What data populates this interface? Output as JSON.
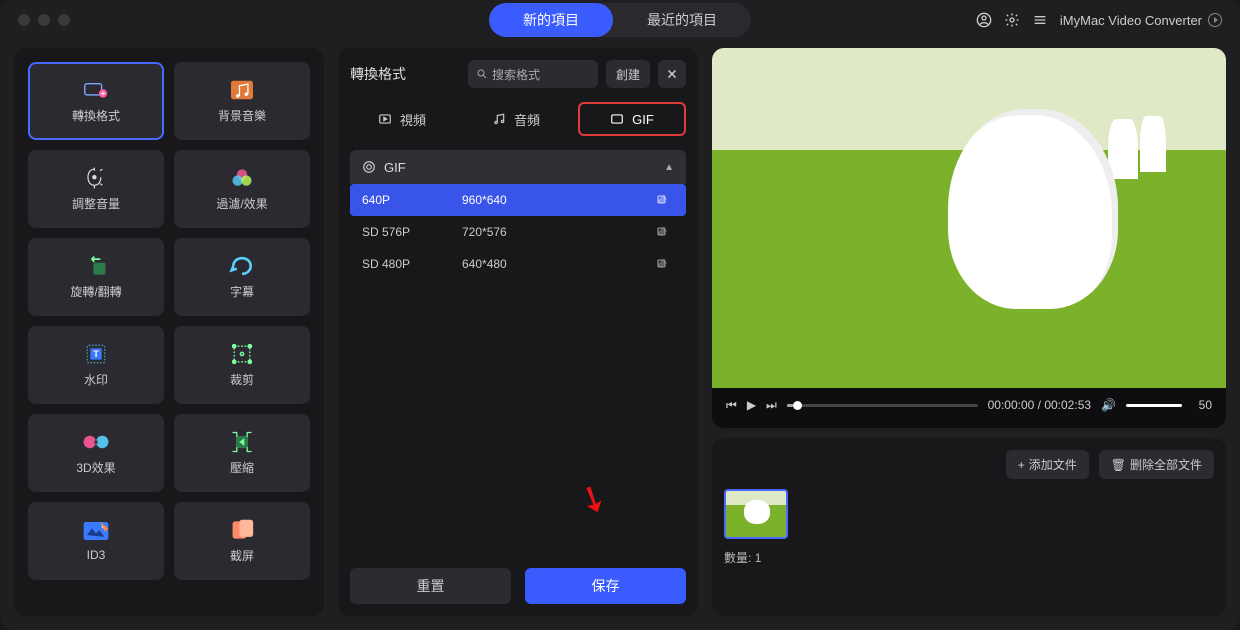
{
  "app": {
    "name": "iMyMac Video Converter"
  },
  "topTabs": {
    "new": "新的項目",
    "recent": "最近的項目"
  },
  "tools": [
    {
      "key": "convert",
      "label": "轉換格式"
    },
    {
      "key": "bgm",
      "label": "背景音樂"
    },
    {
      "key": "volume",
      "label": "調整音量"
    },
    {
      "key": "filter",
      "label": "過濾/效果"
    },
    {
      "key": "rotate",
      "label": "旋轉/翻轉"
    },
    {
      "key": "subtitle",
      "label": "字幕"
    },
    {
      "key": "watermark",
      "label": "水印"
    },
    {
      "key": "crop",
      "label": "裁剪"
    },
    {
      "key": "3d",
      "label": "3D效果"
    },
    {
      "key": "compress",
      "label": "壓縮"
    },
    {
      "key": "id3",
      "label": "ID3"
    },
    {
      "key": "screenshot",
      "label": "截屏"
    }
  ],
  "mid": {
    "title": "轉換格式",
    "searchPlaceholder": "搜索格式",
    "createBtn": "創建",
    "tabs": {
      "video": "視頻",
      "audio": "音頻",
      "gif": "GIF"
    },
    "groupName": "GIF",
    "rows": [
      {
        "name": "640P",
        "res": "960*640"
      },
      {
        "name": "SD 576P",
        "res": "720*576"
      },
      {
        "name": "SD 480P",
        "res": "640*480"
      }
    ],
    "resetBtn": "重置",
    "saveBtn": "保存"
  },
  "player": {
    "currentTime": "00:00:00",
    "duration": "00:02:53",
    "volume": "50"
  },
  "queue": {
    "addBtn": "添加文件",
    "clearBtn": "删除全部文件",
    "countLabel": "數量:",
    "countValue": "1"
  }
}
